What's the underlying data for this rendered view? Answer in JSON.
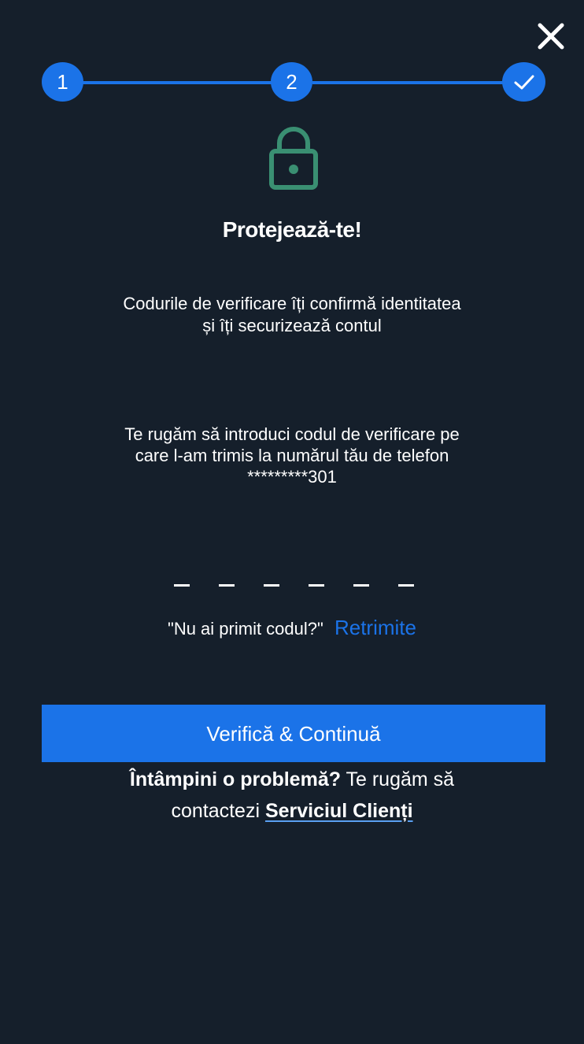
{
  "stepper": {
    "steps": [
      {
        "label": "1"
      },
      {
        "label": "2"
      },
      {
        "label": "✓"
      }
    ],
    "accent_color": "#1b73e8"
  },
  "header": {
    "close_icon": "close-icon",
    "title": "Protejează-te!"
  },
  "lock": {
    "icon": "lock-icon",
    "color": "#3a8f72"
  },
  "body": {
    "subtitle_line1": "Codurile de verificare îți confirmă identitatea",
    "subtitle_line2": "și îți securizează contul",
    "instructions_line1": "Te rugăm să introduci codul de verificare pe",
    "instructions_line2": "care l-am trimis la numărul tău de telefon",
    "masked_phone": "*********301"
  },
  "code": {
    "slots": 6
  },
  "resend": {
    "question": "\"Nu ai primit codul?\"",
    "link_label": "Retrimite"
  },
  "primary_button": {
    "label": "Verifică & Continuă"
  },
  "help": {
    "bold_text": "Întâmpini o problemă?",
    "text": " Te rugăm să contactezi ",
    "link_label": "Serviciul Clienți"
  },
  "colors": {
    "background": "#151f2b",
    "accent": "#1b73e8",
    "lock": "#3a8f72"
  }
}
